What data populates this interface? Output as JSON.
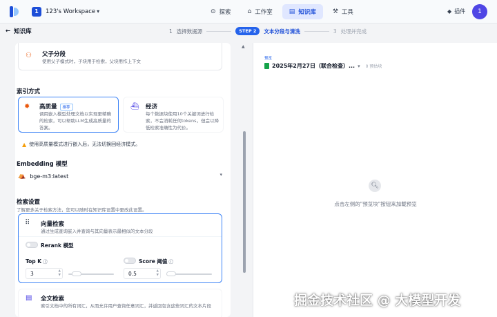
{
  "topbar": {
    "workspace_initial": "1",
    "workspace_name": "123's Workspace",
    "nav": [
      {
        "label": "探索",
        "icon": "compass-icon"
      },
      {
        "label": "工作室",
        "icon": "studio-icon"
      },
      {
        "label": "知识库",
        "icon": "book-icon",
        "active": true
      },
      {
        "label": "工具",
        "icon": "tool-icon"
      }
    ],
    "plugins_label": "插件",
    "avatar_initial": "1"
  },
  "subbar": {
    "back_label": "知识库",
    "step1": "1",
    "step1_label": "选择数据源",
    "step2_pill": "STEP 2",
    "step2_label": "文本分段与清洗",
    "step3": "3",
    "step3_label": "处理并完成"
  },
  "left": {
    "parent_child": {
      "title": "父子分段",
      "desc": "使用父子模式时，子块用于检索，父块用作上下文"
    },
    "index_mode_label": "索引方式",
    "high_quality": {
      "title": "高质量",
      "badge": "推荐",
      "desc": "调用嵌入模型处理文档以实现更精确的检索，可以帮助LLM生成高质量的答案。"
    },
    "economy": {
      "title": "经济",
      "desc": "每个数据块使用10个关键词进行检索，不会消耗任何tokens，但会以降低检索准确性为代价。"
    },
    "warning": "使用高质量模式进行嵌入后，无法切换回经济模式。",
    "embedding_label": "Embedding 模型",
    "embedding_value": "bge-m3:latest",
    "retrieval_label": "检索设置",
    "retrieval_desc": "了解更多关于检索方法，您可以随时在知识库设置中更改此设置。",
    "vector": {
      "title": "向量检索",
      "desc": "通过生成查询嵌入并查询与其向量表示最相似的文本分段",
      "rerank_label": "Rerank 模型",
      "topk_label": "Top K",
      "topk_value": "3",
      "score_label": "Score 阈值",
      "score_value": "0.5",
      "topk_level": 0.1,
      "score_level": 0.0
    },
    "fulltext": {
      "title": "全文检索",
      "desc": "索引文档中的所有词汇，从而允许用户查询任意词汇，并返回包含这些词汇的文本片段"
    }
  },
  "right": {
    "preview_label": "预览",
    "file_name": "2025年2月27日（联合检查）...",
    "file_count": "0 预估块",
    "empty_hint": "点击左侧的\"预览块\"按钮来加载预览"
  },
  "watermark": "掘金技术社区 @ 大模型开发",
  "colors": {
    "accent": "#2563eb",
    "warning": "#f59e0b",
    "excel": "#16a34a"
  }
}
